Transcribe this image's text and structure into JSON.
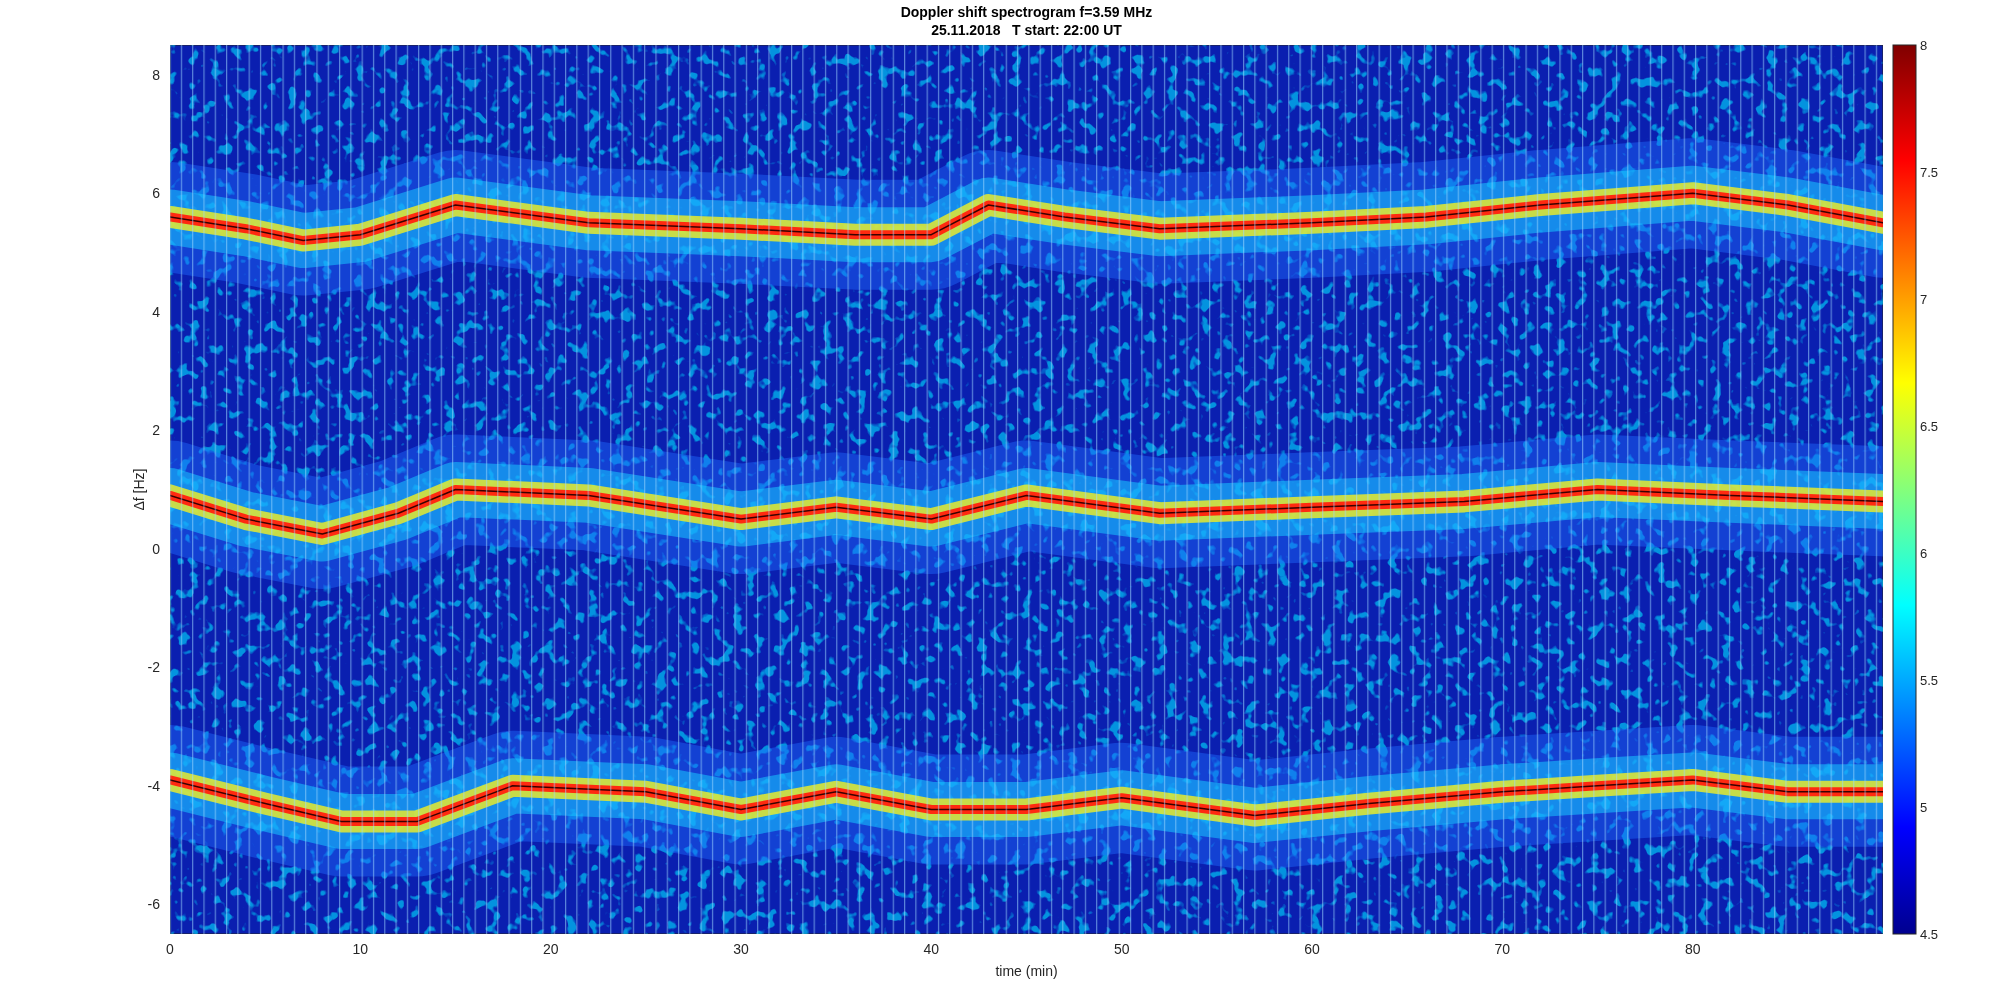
{
  "figure": {
    "title": [
      "Doppler shift spectrogram f=3.59 MHz",
      "25.11.2018   T start: 22:00 UT"
    ],
    "xlabel": "time (min)",
    "ylabel": "Δf [Hz]",
    "xticks": [
      "0",
      "10",
      "20",
      "30",
      "40",
      "50",
      "60",
      "70",
      "80"
    ],
    "yticks": [
      "8",
      "6",
      "4",
      "2",
      "0",
      "-2",
      "-4",
      "-6"
    ],
    "colorbar_ticks": [
      "8",
      "7.5",
      "7",
      "6.5",
      "6",
      "5.5",
      "5",
      "4.5"
    ]
  }
}
